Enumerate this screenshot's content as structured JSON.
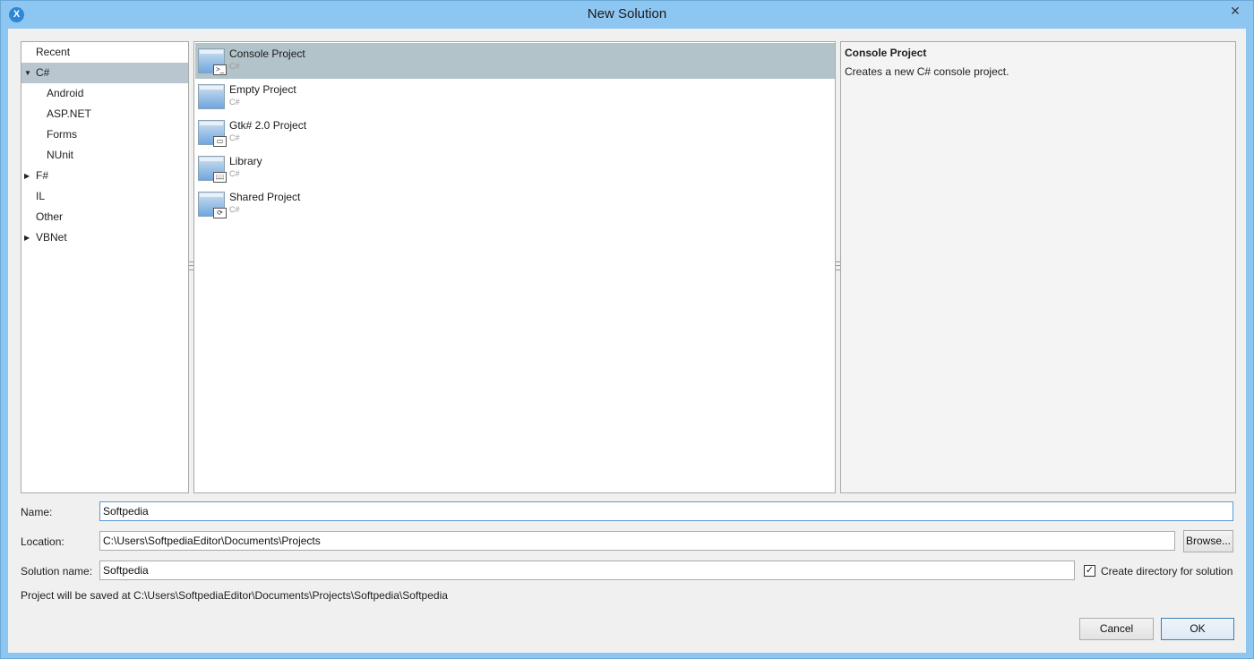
{
  "window": {
    "title": "New Solution",
    "app_icon": "xamarin-icon",
    "close_glyph": "✕"
  },
  "categories": [
    {
      "label": "Recent",
      "expanded": null,
      "selected": false,
      "indent": 0
    },
    {
      "label": "C#",
      "expanded": true,
      "selected": true,
      "indent": 0
    },
    {
      "label": "Android",
      "expanded": null,
      "selected": false,
      "indent": 1
    },
    {
      "label": "ASP.NET",
      "expanded": null,
      "selected": false,
      "indent": 1
    },
    {
      "label": "Forms",
      "expanded": null,
      "selected": false,
      "indent": 1
    },
    {
      "label": "NUnit",
      "expanded": null,
      "selected": false,
      "indent": 1
    },
    {
      "label": "F#",
      "expanded": false,
      "selected": false,
      "indent": 0
    },
    {
      "label": "IL",
      "expanded": null,
      "selected": false,
      "indent": 0
    },
    {
      "label": "Other",
      "expanded": null,
      "selected": false,
      "indent": 0
    },
    {
      "label": "VBNet",
      "expanded": false,
      "selected": false,
      "indent": 0
    }
  ],
  "templates": [
    {
      "name": "Console Project",
      "lang": "C#",
      "badge": ">_",
      "icon": "console-project-icon",
      "selected": true
    },
    {
      "name": "Empty Project",
      "lang": "C#",
      "badge": "",
      "icon": "empty-project-icon",
      "selected": false
    },
    {
      "name": "Gtk# 2.0 Project",
      "lang": "C#",
      "badge": "▭",
      "icon": "gtk-project-icon",
      "selected": false
    },
    {
      "name": "Library",
      "lang": "C#",
      "badge": "📖",
      "icon": "library-project-icon",
      "selected": false
    },
    {
      "name": "Shared Project",
      "lang": "C#",
      "badge": "⟳",
      "icon": "shared-project-icon",
      "selected": false
    }
  ],
  "description": {
    "title": "Console Project",
    "text": "Creates a new C# console project."
  },
  "form": {
    "name_label": "Name:",
    "name_value": "Softpedia",
    "location_label": "Location:",
    "location_value": "C:\\Users\\SoftpediaEditor\\Documents\\Projects",
    "browse_label": "Browse...",
    "solution_label": "Solution name:",
    "solution_value": "Softpedia",
    "create_dir_label": "Create directory for solution",
    "create_dir_checked": true,
    "save_note": "Project will be saved at C:\\Users\\SoftpediaEditor\\Documents\\Projects\\Softpedia\\Softpedia"
  },
  "buttons": {
    "cancel": "Cancel",
    "ok": "OK"
  },
  "colors": {
    "title_bar": "#8ec6f2",
    "selection": "#b3c3ca"
  }
}
